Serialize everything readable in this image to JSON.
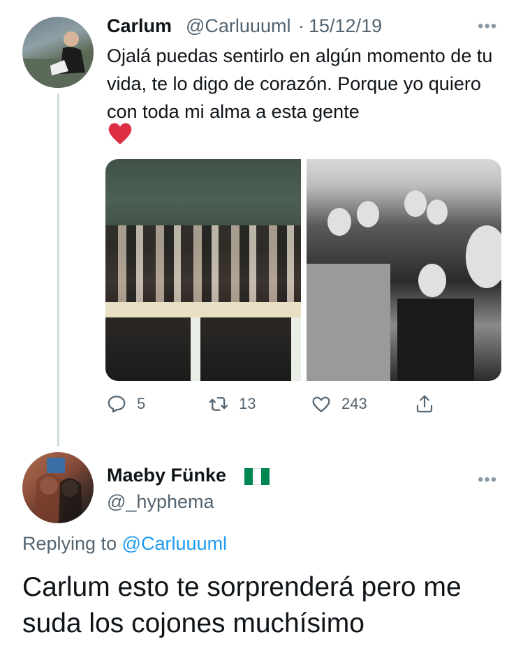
{
  "tweet": {
    "author_name": "Carlum",
    "author_handle": "@Carluuuml",
    "separator": "·",
    "date": "15/12/19",
    "text": "Ojalá puedas sentirlo en algún momento de tu vida, te lo digo de corazón. Porque yo quiero con toda mi alma a esta gente",
    "emoji_icon": "red-heart-emoji",
    "more_icon": "more-options-icon",
    "stats": {
      "replies": "5",
      "retweets": "13",
      "likes": "243"
    }
  },
  "reply": {
    "author_name": "Maeby Fünke",
    "flag_icon": "nigeria-flag-emoji",
    "author_handle": "@_hyphema",
    "replying_prefix": "Replying to",
    "replying_to": "@Carluuuml",
    "text": "Carlum esto te sorprenderá pero me suda los cojones muchísimo",
    "more_icon": "more-options-icon"
  },
  "colors": {
    "text_primary": "#0f1419",
    "text_secondary": "#536471",
    "link": "#1d9bf0",
    "thread_line": "#cfd9de",
    "heart_red": "#e0245e",
    "flag_green": "#008751"
  }
}
